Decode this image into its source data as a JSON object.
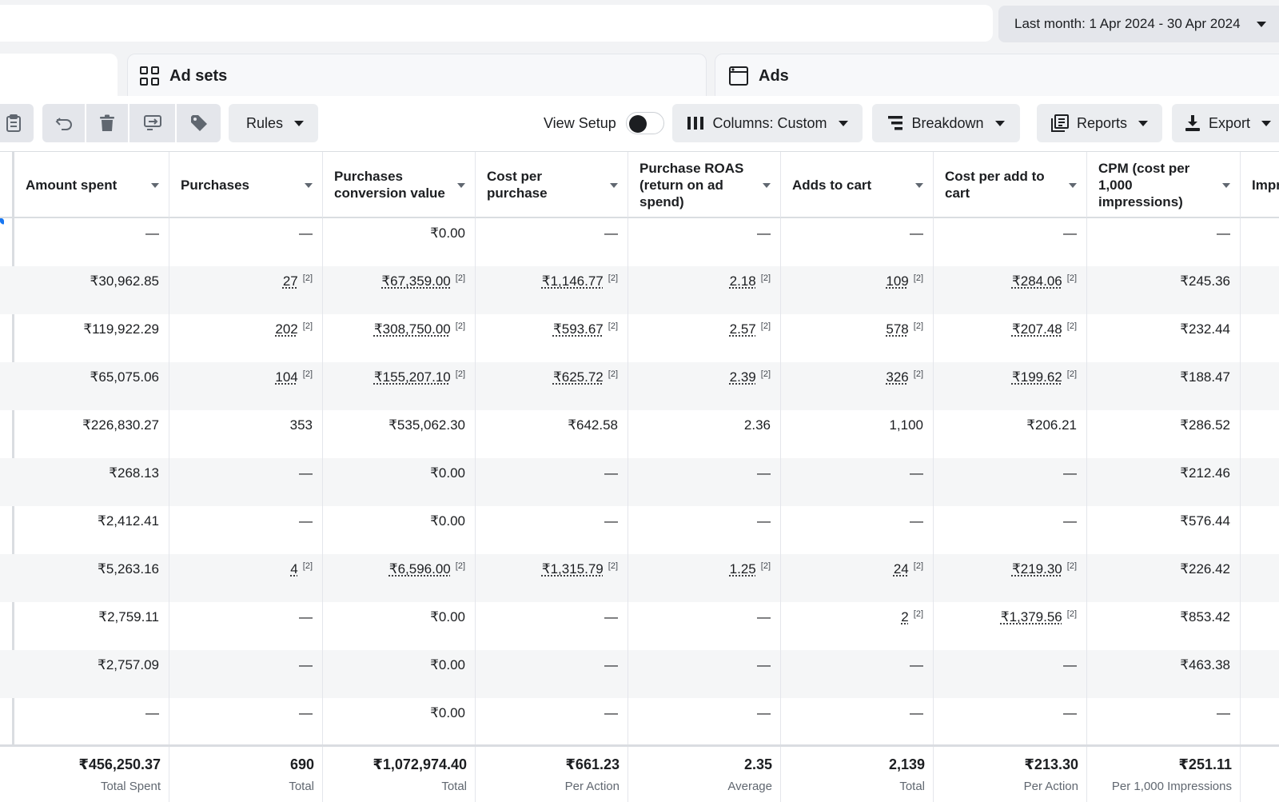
{
  "date_range": {
    "label": "Last month: 1 Apr 2024 - 30 Apr 2024"
  },
  "tabs": {
    "ad_sets": "Ad sets",
    "ads": "Ads"
  },
  "toolbar": {
    "rules": "Rules",
    "view_setup": "View Setup",
    "columns": "Columns: Custom",
    "breakdown": "Breakdown",
    "reports": "Reports",
    "export": "Export"
  },
  "table": {
    "columns": [
      "Amount spent",
      "Purchases",
      "Purchases conversion value",
      "Cost per purchase",
      "Purchase ROAS (return on ad spend)",
      "Adds to cart",
      "Cost per add to cart",
      "CPM (cost per 1,000 impressions)",
      "Impr"
    ],
    "rows": [
      [
        "—",
        "—",
        "₹0.00",
        "—",
        "—",
        "—",
        "—",
        "—"
      ],
      [
        "₹30,962.85",
        "27",
        "₹67,359.00",
        "₹1,146.77",
        "2.18",
        "109",
        "₹284.06",
        "₹245.36"
      ],
      [
        "₹119,922.29",
        "202",
        "₹308,750.00",
        "₹593.67",
        "2.57",
        "578",
        "₹207.48",
        "₹232.44"
      ],
      [
        "₹65,075.06",
        "104",
        "₹155,207.10",
        "₹625.72",
        "2.39",
        "326",
        "₹199.62",
        "₹188.47"
      ],
      [
        "₹226,830.27",
        "353",
        "₹535,062.30",
        "₹642.58",
        "2.36",
        "1,100",
        "₹206.21",
        "₹286.52"
      ],
      [
        "₹268.13",
        "—",
        "₹0.00",
        "—",
        "—",
        "—",
        "—",
        "₹212.46"
      ],
      [
        "₹2,412.41",
        "—",
        "₹0.00",
        "—",
        "—",
        "—",
        "—",
        "₹576.44"
      ],
      [
        "₹5,263.16",
        "4",
        "₹6,596.00",
        "₹1,315.79",
        "1.25",
        "24",
        "₹219.30",
        "₹226.42"
      ],
      [
        "₹2,759.11",
        "—",
        "₹0.00",
        "—",
        "—",
        "2",
        "₹1,379.56",
        "₹853.42"
      ],
      [
        "₹2,757.09",
        "—",
        "₹0.00",
        "—",
        "—",
        "—",
        "—",
        "₹463.38"
      ],
      [
        "—",
        "—",
        "₹0.00",
        "—",
        "—",
        "—",
        "—",
        "—"
      ]
    ],
    "footnote_marker": "[2]",
    "footnoted_cells": [
      [
        1,
        1
      ],
      [
        1,
        2
      ],
      [
        1,
        3
      ],
      [
        1,
        4
      ],
      [
        1,
        5
      ],
      [
        1,
        6
      ],
      [
        2,
        1
      ],
      [
        2,
        2
      ],
      [
        2,
        3
      ],
      [
        2,
        4
      ],
      [
        2,
        5
      ],
      [
        2,
        6
      ],
      [
        3,
        1
      ],
      [
        3,
        2
      ],
      [
        3,
        3
      ],
      [
        3,
        4
      ],
      [
        3,
        5
      ],
      [
        3,
        6
      ],
      [
        7,
        1
      ],
      [
        7,
        2
      ],
      [
        7,
        3
      ],
      [
        7,
        4
      ],
      [
        7,
        5
      ],
      [
        7,
        6
      ],
      [
        8,
        5
      ],
      [
        8,
        6
      ]
    ],
    "totals": [
      {
        "value": "₹456,250.37",
        "label": "Total Spent"
      },
      {
        "value": "690",
        "label": "Total"
      },
      {
        "value": "₹1,072,974.40",
        "label": "Total"
      },
      {
        "value": "₹661.23",
        "label": "Per Action"
      },
      {
        "value": "2.35",
        "label": "Average"
      },
      {
        "value": "2,139",
        "label": "Total"
      },
      {
        "value": "₹213.30",
        "label": "Per Action"
      },
      {
        "value": "₹251.11",
        "label": "Per 1,000 Impressions"
      }
    ]
  }
}
